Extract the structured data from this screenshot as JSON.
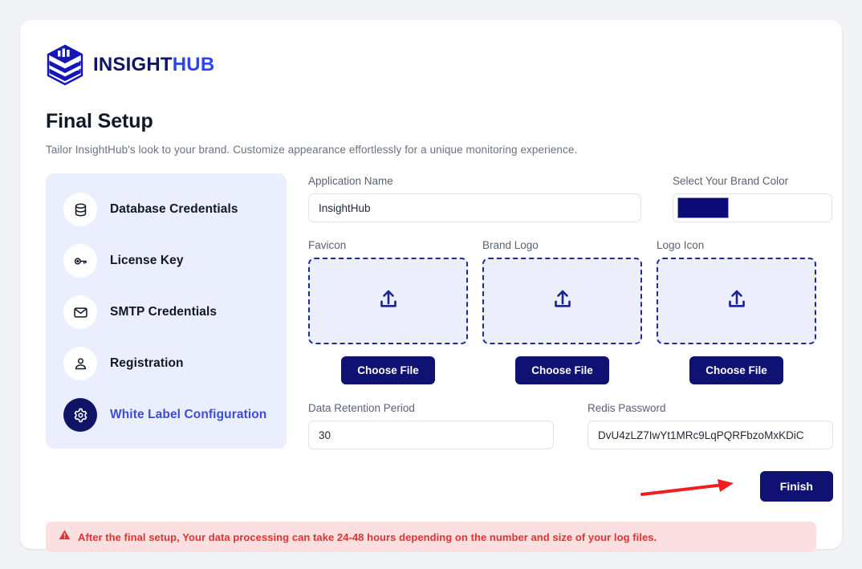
{
  "brand": {
    "name_part1": "INSIGHT",
    "name_part2": "HUB",
    "logo_icon": "layered-hexagon-database-icon",
    "color_part1": "#0f1466",
    "color_part2": "#2b46f0"
  },
  "header": {
    "title": "Final Setup",
    "subtitle": "Tailor InsightHub's look to your brand. Customize appearance effortlessly for a unique monitoring experience."
  },
  "sidebar": {
    "items": [
      {
        "label": "Database Credentials",
        "icon": "database-icon",
        "active": false
      },
      {
        "label": "License Key",
        "icon": "key-icon",
        "active": false
      },
      {
        "label": "SMTP Credentials",
        "icon": "envelope-icon",
        "active": false
      },
      {
        "label": "Registration",
        "icon": "user-icon",
        "active": false
      },
      {
        "label": "White Label Configuration",
        "icon": "gear-icon",
        "active": true
      }
    ],
    "active_color": "#3b4cd8",
    "panel_color": "#ebeefc"
  },
  "form": {
    "app_name": {
      "label": "Application Name",
      "value": "InsightHub",
      "placeholder": "Application Name"
    },
    "brand_color": {
      "label": "Select Your Brand Color",
      "value": "#0a0a78"
    },
    "uploads": [
      {
        "label": "Favicon",
        "icon": "upload-icon",
        "button": "Choose File"
      },
      {
        "label": "Brand Logo",
        "icon": "upload-icon",
        "button": "Choose File"
      },
      {
        "label": "Logo Icon",
        "icon": "upload-icon",
        "button": "Choose File"
      }
    ],
    "retention": {
      "label": "Data Retention Period",
      "value": "30",
      "placeholder": "Data Retention Period"
    },
    "redis": {
      "label": "Redis Password",
      "value": "DvU4zLZ7IwYt1MRc9LqPQRFbzoMxKDiC",
      "placeholder": "Redis Password"
    }
  },
  "actions": {
    "finish_label": "Finish",
    "arrow_color": "#f01e20"
  },
  "alert": {
    "icon": "warning-triangle-icon",
    "text": "After the final setup, Your data processing can take 24-48 hours depending on the number and size of your log files.",
    "color": "#e03232",
    "background": "#fcdfe0"
  }
}
